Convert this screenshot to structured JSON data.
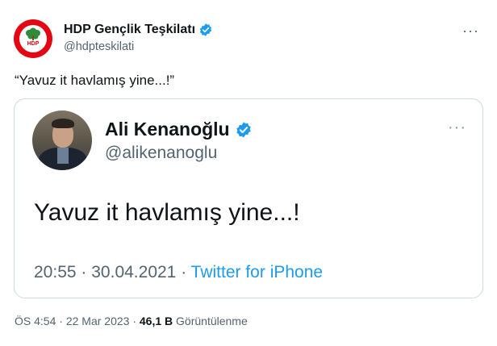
{
  "author": {
    "name": "HDP Gençlik Teşkilatı",
    "handle": "@hdpteskilati",
    "avatar_label": "HDP",
    "verified_icon": "verified-badge-icon"
  },
  "tweet": {
    "text": "“Yavuz it havlamış yine...!”"
  },
  "quoted_screenshot": {
    "name": "Ali Kenanoğlu",
    "handle": "@alikenanoglu",
    "text": "Yavuz it havlamış yine...!",
    "time": "20:55",
    "date": "30.04.2021",
    "separator": "·",
    "source": "Twitter for iPhone"
  },
  "footer": {
    "time": "ÖS 4:54",
    "date": "22 Mar 2023",
    "separator": "·",
    "views_count": "46,1 B",
    "views_label": "Görüntülenme"
  },
  "colors": {
    "brand_red": "#e30613",
    "verified_blue": "#1d9bf0",
    "secondary_text": "#536471"
  }
}
